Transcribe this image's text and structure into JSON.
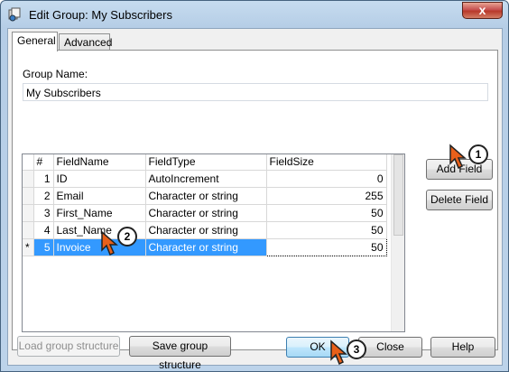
{
  "window": {
    "title": "Edit Group: My Subscribers",
    "close_glyph": "x"
  },
  "tabs": [
    {
      "label": "General",
      "active": true
    },
    {
      "label": "Advanced",
      "active": false
    }
  ],
  "group": {
    "name_label": "Group Name:",
    "name_value": "My Subscribers"
  },
  "grid": {
    "columns": [
      "#",
      "FieldName",
      "FieldType",
      "FieldSize"
    ],
    "rows": [
      {
        "indicator": "",
        "num": "1",
        "name": "ID",
        "type": "AutoIncrement",
        "size": "0"
      },
      {
        "indicator": "",
        "num": "2",
        "name": "Email",
        "type": "Character or string",
        "size": "255"
      },
      {
        "indicator": "",
        "num": "3",
        "name": "First_Name",
        "type": "Character or string",
        "size": "50"
      },
      {
        "indicator": "",
        "num": "4",
        "name": "Last_Name",
        "type": "Character or string",
        "size": "50"
      },
      {
        "indicator": "*",
        "num": "5",
        "name": "Invoice",
        "type": "Character or string",
        "size": "50"
      }
    ],
    "selected_row": 5
  },
  "buttons": {
    "add_field": "Add Field",
    "delete_field": "Delete Field",
    "load_structure": "Load group structure",
    "save_structure": "Save group structure",
    "ok": "OK",
    "close": "Close",
    "help": "Help"
  },
  "callouts": [
    "1",
    "2",
    "3"
  ],
  "colors": {
    "selection": "#3399ff",
    "callout_arrow": "#e8601a"
  }
}
